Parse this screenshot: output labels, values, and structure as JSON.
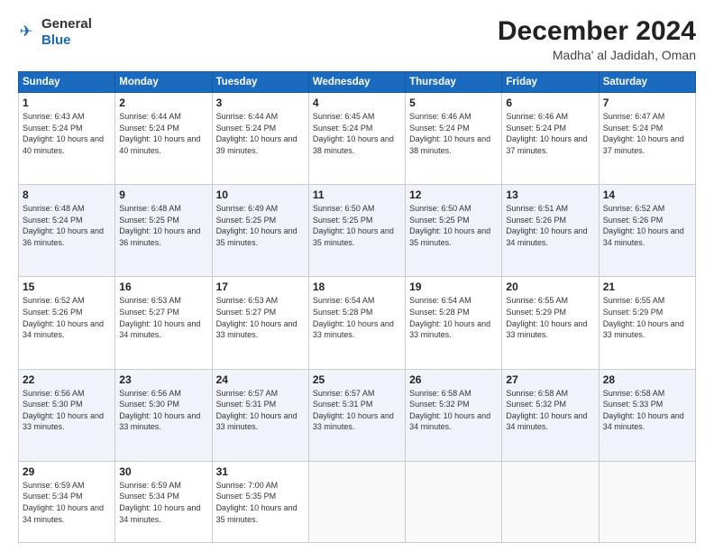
{
  "logo": {
    "general": "General",
    "blue": "Blue"
  },
  "header": {
    "month": "December 2024",
    "location": "Madha' al Jadidah, Oman"
  },
  "weekdays": [
    "Sunday",
    "Monday",
    "Tuesday",
    "Wednesday",
    "Thursday",
    "Friday",
    "Saturday"
  ],
  "weeks": [
    [
      {
        "day": "1",
        "sunrise": "6:43 AM",
        "sunset": "5:24 PM",
        "daylight": "10 hours and 40 minutes."
      },
      {
        "day": "2",
        "sunrise": "6:44 AM",
        "sunset": "5:24 PM",
        "daylight": "10 hours and 40 minutes."
      },
      {
        "day": "3",
        "sunrise": "6:44 AM",
        "sunset": "5:24 PM",
        "daylight": "10 hours and 39 minutes."
      },
      {
        "day": "4",
        "sunrise": "6:45 AM",
        "sunset": "5:24 PM",
        "daylight": "10 hours and 38 minutes."
      },
      {
        "day": "5",
        "sunrise": "6:46 AM",
        "sunset": "5:24 PM",
        "daylight": "10 hours and 38 minutes."
      },
      {
        "day": "6",
        "sunrise": "6:46 AM",
        "sunset": "5:24 PM",
        "daylight": "10 hours and 37 minutes."
      },
      {
        "day": "7",
        "sunrise": "6:47 AM",
        "sunset": "5:24 PM",
        "daylight": "10 hours and 37 minutes."
      }
    ],
    [
      {
        "day": "8",
        "sunrise": "6:48 AM",
        "sunset": "5:24 PM",
        "daylight": "10 hours and 36 minutes."
      },
      {
        "day": "9",
        "sunrise": "6:48 AM",
        "sunset": "5:25 PM",
        "daylight": "10 hours and 36 minutes."
      },
      {
        "day": "10",
        "sunrise": "6:49 AM",
        "sunset": "5:25 PM",
        "daylight": "10 hours and 35 minutes."
      },
      {
        "day": "11",
        "sunrise": "6:50 AM",
        "sunset": "5:25 PM",
        "daylight": "10 hours and 35 minutes."
      },
      {
        "day": "12",
        "sunrise": "6:50 AM",
        "sunset": "5:25 PM",
        "daylight": "10 hours and 35 minutes."
      },
      {
        "day": "13",
        "sunrise": "6:51 AM",
        "sunset": "5:26 PM",
        "daylight": "10 hours and 34 minutes."
      },
      {
        "day": "14",
        "sunrise": "6:52 AM",
        "sunset": "5:26 PM",
        "daylight": "10 hours and 34 minutes."
      }
    ],
    [
      {
        "day": "15",
        "sunrise": "6:52 AM",
        "sunset": "5:26 PM",
        "daylight": "10 hours and 34 minutes."
      },
      {
        "day": "16",
        "sunrise": "6:53 AM",
        "sunset": "5:27 PM",
        "daylight": "10 hours and 34 minutes."
      },
      {
        "day": "17",
        "sunrise": "6:53 AM",
        "sunset": "5:27 PM",
        "daylight": "10 hours and 33 minutes."
      },
      {
        "day": "18",
        "sunrise": "6:54 AM",
        "sunset": "5:28 PM",
        "daylight": "10 hours and 33 minutes."
      },
      {
        "day": "19",
        "sunrise": "6:54 AM",
        "sunset": "5:28 PM",
        "daylight": "10 hours and 33 minutes."
      },
      {
        "day": "20",
        "sunrise": "6:55 AM",
        "sunset": "5:29 PM",
        "daylight": "10 hours and 33 minutes."
      },
      {
        "day": "21",
        "sunrise": "6:55 AM",
        "sunset": "5:29 PM",
        "daylight": "10 hours and 33 minutes."
      }
    ],
    [
      {
        "day": "22",
        "sunrise": "6:56 AM",
        "sunset": "5:30 PM",
        "daylight": "10 hours and 33 minutes."
      },
      {
        "day": "23",
        "sunrise": "6:56 AM",
        "sunset": "5:30 PM",
        "daylight": "10 hours and 33 minutes."
      },
      {
        "day": "24",
        "sunrise": "6:57 AM",
        "sunset": "5:31 PM",
        "daylight": "10 hours and 33 minutes."
      },
      {
        "day": "25",
        "sunrise": "6:57 AM",
        "sunset": "5:31 PM",
        "daylight": "10 hours and 33 minutes."
      },
      {
        "day": "26",
        "sunrise": "6:58 AM",
        "sunset": "5:32 PM",
        "daylight": "10 hours and 34 minutes."
      },
      {
        "day": "27",
        "sunrise": "6:58 AM",
        "sunset": "5:32 PM",
        "daylight": "10 hours and 34 minutes."
      },
      {
        "day": "28",
        "sunrise": "6:58 AM",
        "sunset": "5:33 PM",
        "daylight": "10 hours and 34 minutes."
      }
    ],
    [
      {
        "day": "29",
        "sunrise": "6:59 AM",
        "sunset": "5:34 PM",
        "daylight": "10 hours and 34 minutes."
      },
      {
        "day": "30",
        "sunrise": "6:59 AM",
        "sunset": "5:34 PM",
        "daylight": "10 hours and 34 minutes."
      },
      {
        "day": "31",
        "sunrise": "7:00 AM",
        "sunset": "5:35 PM",
        "daylight": "10 hours and 35 minutes."
      },
      null,
      null,
      null,
      null
    ]
  ]
}
